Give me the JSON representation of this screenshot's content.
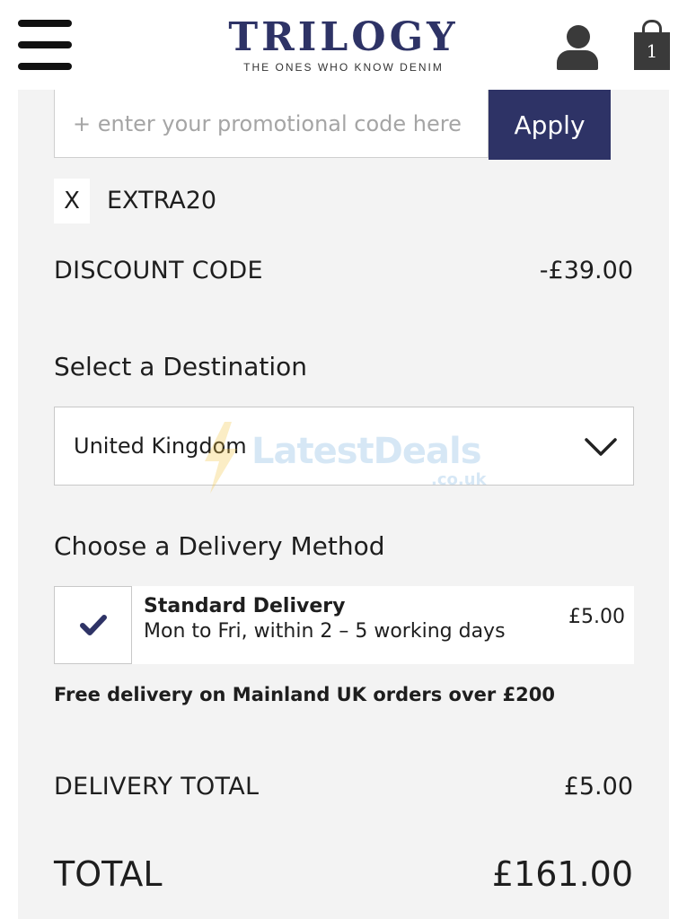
{
  "header": {
    "logo_word": "TRILOGY",
    "logo_tagline": "THE ONES WHO KNOW DENIM",
    "menu_icon": "hamburger-menu-icon",
    "account_icon": "user-account-icon",
    "bag_icon": "shopping-bag-icon",
    "bag_count": "1",
    "brand_color": "#2e3366"
  },
  "promo": {
    "placeholder": "+ enter your promotional code here",
    "value": "",
    "apply_label": "Apply",
    "remove_label": "X",
    "applied_code": "EXTRA20"
  },
  "discount": {
    "label": "DISCOUNT CODE",
    "value": "-£39.00"
  },
  "destination": {
    "title": "Select a Destination",
    "selected": "United Kingdom"
  },
  "watermark": {
    "text": "LatestDeals",
    "sub": ".co.uk"
  },
  "delivery": {
    "title": "Choose a Delivery Method",
    "option": {
      "name": "Standard Delivery",
      "description": "Mon to Fri, within 2 – 5 working days",
      "price": "£5.00",
      "selected": true
    },
    "free_note": "Free delivery on Mainland UK orders over £200"
  },
  "delivery_total": {
    "label": "DELIVERY TOTAL",
    "value": "£5.00"
  },
  "total": {
    "label": "TOTAL",
    "value": "£161.00"
  }
}
